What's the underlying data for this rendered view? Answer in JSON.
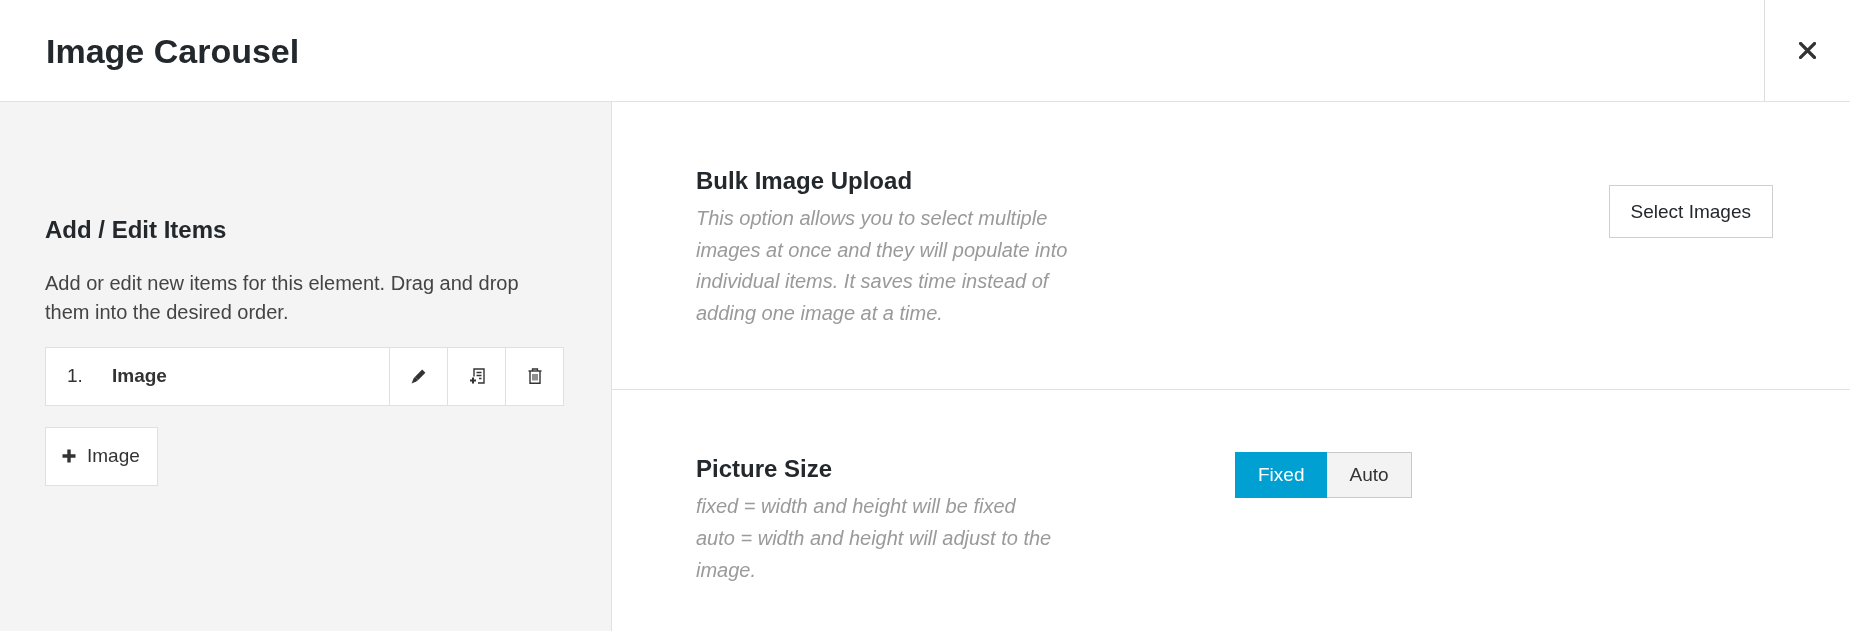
{
  "window": {
    "title": "Image Carousel"
  },
  "items_panel": {
    "title": "Add / Edit Items",
    "description": "Add or edit new items for this element. Drag and drop them into the desired order.",
    "items": [
      {
        "number": "1.",
        "label": "Image"
      }
    ],
    "add_button": {
      "label": "Image"
    }
  },
  "settings": [
    {
      "kind": "button",
      "title": "Bulk Image Upload",
      "description": "This option allows you to select multiple images at once and they will populate into individual items. It saves time instead of adding one image at a time.",
      "button": "Select Images"
    },
    {
      "kind": "toggle",
      "title": "Picture Size",
      "description": "fixed = width and height will be fixed\nauto = width and height will adjust to the image.",
      "options": [
        {
          "label": "Fixed",
          "selected": true
        },
        {
          "label": "Auto",
          "selected": false
        }
      ]
    }
  ]
}
